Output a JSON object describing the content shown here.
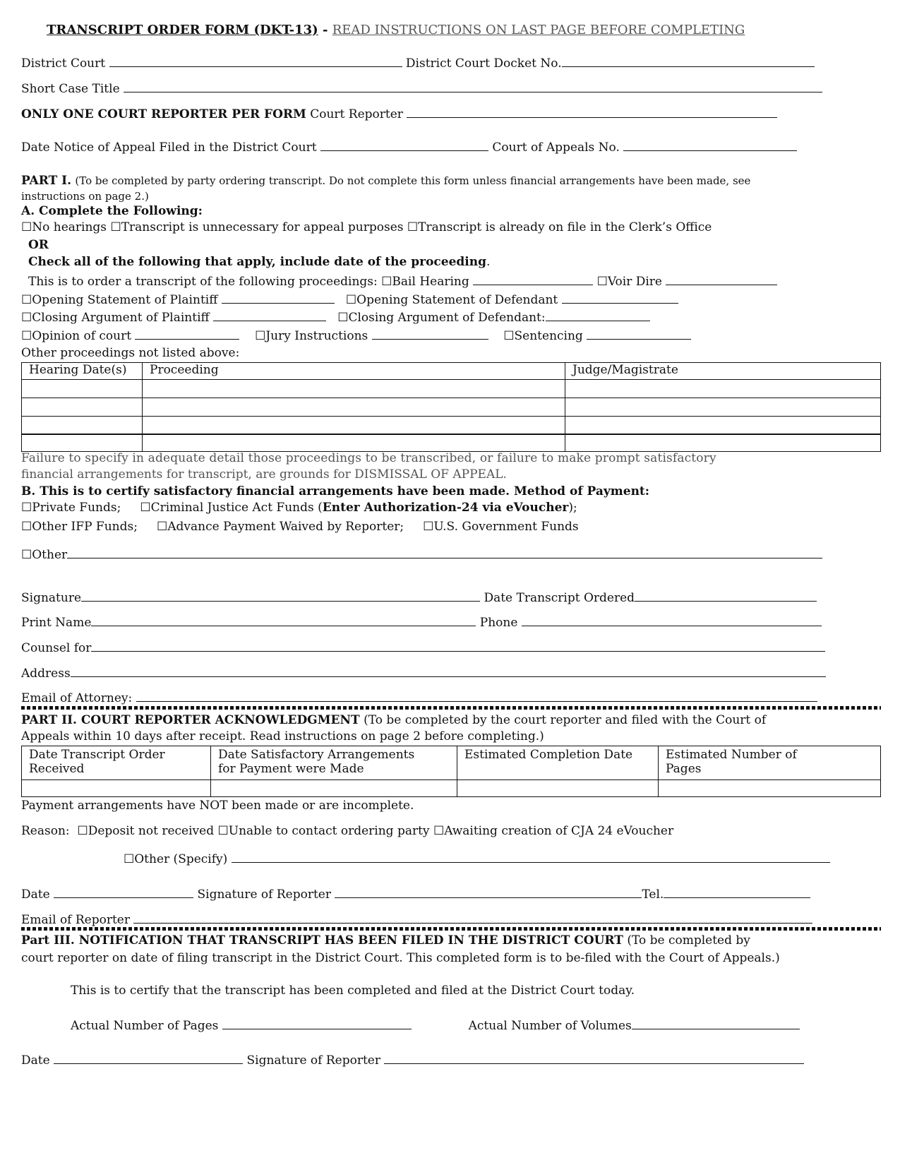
{
  "header": {
    "title": "TRANSCRIPT ORDER FORM (DKT-13)",
    "separator": " - ",
    "subtitle": "READ INSTRUCTIONS ON LAST PAGE BEFORE COMPLETING"
  },
  "top_fields": {
    "district_court": "District Court",
    "docket_no": "District Court Docket No.",
    "short_case_title": "Short Case Title",
    "one_reporter": "ONLY ONE COURT REPORTER PER FORM",
    "court_reporter": "Court Reporter",
    "notice_date": "Date Notice of Appeal Filed in the District Court",
    "appeals_no": "Court of Appeals No."
  },
  "part1": {
    "heading": "PART I.",
    "intro": "(To be completed by party ordering transcript.  Do not complete this form unless financial arrangements have been made, see",
    "intro2": "instructions on page 2.)",
    "section_a": "A.  Complete the Following:",
    "checkbox_glyph": "☐",
    "options_a": [
      "No hearings",
      "Transcript is unnecessary for appeal purposes",
      "Transcript is already on file in the Clerk’s Office"
    ],
    "or": "OR",
    "check_all": "Check all of the following that apply, include date of the proceeding",
    "check_all_period": ".",
    "order_intro": "This is to order a transcript of the following proceedings:",
    "proceedings": {
      "bail_hearing": "Bail Hearing",
      "voir_dire": "Voir Dire",
      "opening_plaintiff": "Opening Statement of Plaintiff",
      "opening_defendant": "Opening Statement of Defendant",
      "closing_plaintiff": "Closing Argument of Plaintiff",
      "closing_defendant": "Closing Argument of Defendant:",
      "opinion": "Opinion of court",
      "jury": "Jury Instructions",
      "sentencing": "Sentencing"
    },
    "other_proceedings": "Other proceedings not listed above:",
    "table": {
      "headers": [
        "Hearing Date(s)",
        "Proceeding",
        "Judge/Magistrate"
      ],
      "rows": [
        [
          "",
          "",
          ""
        ],
        [
          "",
          "",
          ""
        ],
        [
          "",
          "",
          ""
        ],
        [
          "",
          "",
          ""
        ]
      ]
    },
    "warning_line1": "Failure to specify in adequate detail those proceedings to be transcribed, or failure to make prompt satisfactory",
    "warning_line2": "financial arrangements for transcript, are grounds for DISMISSAL OF APPEAL.",
    "section_b": "B.  This is to certify satisfactory financial arrangements have been made.  Method of Payment:",
    "payment": {
      "private": "Private Funds;",
      "cja": "Criminal Justice Act Funds (",
      "cja_bold": "Enter Authorization-24 via eVoucher",
      "cja_end": ");",
      "ifp": "Other IFP Funds;",
      "waived": "Advance Payment Waived by Reporter;",
      "gov": "U.S. Government Funds",
      "other": "Other"
    },
    "signature": "Signature",
    "date_ordered": "Date Transcript Ordered",
    "print_name": "Print Name",
    "phone": "Phone",
    "counsel_for": "Counsel for",
    "address": "Address",
    "email_attorney": "Email of Attorney:"
  },
  "part2": {
    "heading": "PART II.  COURT REPORTER ACKNOWLEDGMENT",
    "intro": "(To be completed by the court reporter and filed with the Court of",
    "intro2": "Appeals within 10 days after receipt.  Read instructions on page 2 before completing.)",
    "table": {
      "headers": [
        [
          "Date Transcript Order",
          "Received"
        ],
        [
          "Date Satisfactory Arrangements",
          "for Payment were Made"
        ],
        [
          "Estimated Completion Date",
          ""
        ],
        [
          "Estimated Number of",
          "Pages"
        ]
      ],
      "rows": [
        [
          "",
          "",
          "",
          ""
        ]
      ]
    },
    "not_made": "Payment arrangements have NOT been made or are incomplete.",
    "reason_label": "Reason:",
    "reasons": [
      "Deposit not received",
      "Unable to contact ordering party",
      "Awaiting creation of CJA 24 eVoucher"
    ],
    "other_specify": "Other (Specify)",
    "date": "Date",
    "sig_reporter": "Signature of Reporter",
    "tel": "Tel.",
    "email_reporter": "Email of Reporter"
  },
  "part3": {
    "heading": "Part III.  NOTIFICATION THAT TRANSCRIPT HAS BEEN FILED IN THE DISTRICT COURT",
    "intro": "(To be completed by",
    "intro2": "court reporter on date of filing transcript in the District Court.  This completed form is to be-filed with the Court of Appeals.)",
    "certify": "This is to certify that the transcript has been completed and filed at the District Court today.",
    "actual_pages": "Actual Number of Pages",
    "actual_volumes": "Actual Number of Volumes",
    "date": "Date",
    "sig_reporter": "Signature of Reporter"
  }
}
